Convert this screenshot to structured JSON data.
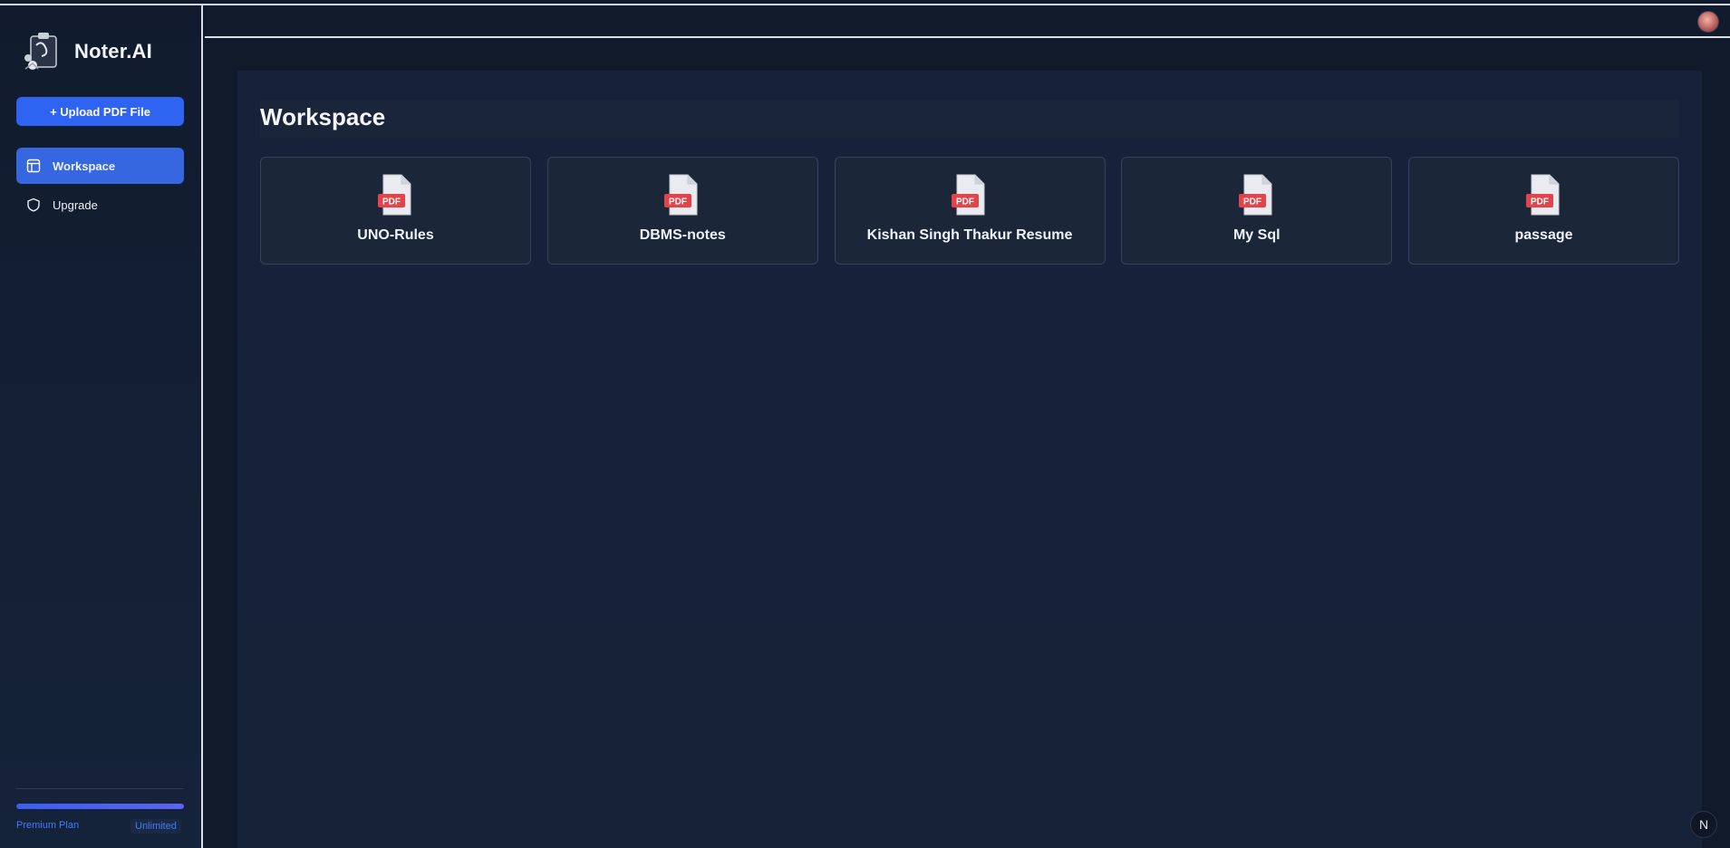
{
  "app": {
    "name": "Noter.AI"
  },
  "sidebar": {
    "upload_label": "+ Upload PDF File",
    "items": [
      {
        "label": "Workspace",
        "icon": "layout-icon",
        "active": true
      },
      {
        "label": "Upgrade",
        "icon": "shield-icon",
        "active": false
      }
    ],
    "plan": {
      "name": "Premium Plan",
      "badge": "Unlimited",
      "usage_fraction": 1.0
    }
  },
  "main": {
    "title": "Workspace",
    "files": [
      {
        "name": "UNO-Rules",
        "type": "PDF"
      },
      {
        "name": "DBMS-notes",
        "type": "PDF"
      },
      {
        "name": "Kishan Singh Thakur Resume",
        "type": "PDF"
      },
      {
        "name": "My Sql",
        "type": "PDF"
      },
      {
        "name": "passage",
        "type": "PDF"
      }
    ]
  },
  "corner_badge": "N",
  "colors": {
    "accent": "#2f63f2",
    "active_nav": "#3666e0",
    "pdf_red": "#e2444a",
    "background": "#111a2b"
  }
}
